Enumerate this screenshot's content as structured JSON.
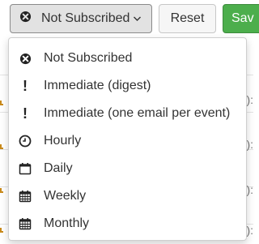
{
  "toolbar": {
    "subscription_label": "Not Subscribed",
    "reset_label": "Reset",
    "save_label": "Sav"
  },
  "menu": {
    "items": [
      {
        "label": "Not Subscribed",
        "icon": "not-subscribed-icon"
      },
      {
        "label": "Immediate (digest)",
        "icon": "exclamation-icon"
      },
      {
        "label": "Immediate (one email per event)",
        "icon": "exclamation-icon"
      },
      {
        "label": "Hourly",
        "icon": "clock-icon"
      },
      {
        "label": "Daily",
        "icon": "calendar-empty-icon"
      },
      {
        "label": "Weekly",
        "icon": "calendar-icon"
      },
      {
        "label": "Monthly",
        "icon": "calendar-icon"
      }
    ]
  },
  "background": {
    "row_suffix": "):"
  },
  "colors": {
    "save_button": "#4cae4c",
    "dropdown_button_bg": "#e2e2e2",
    "border": "#cfcfcf"
  }
}
